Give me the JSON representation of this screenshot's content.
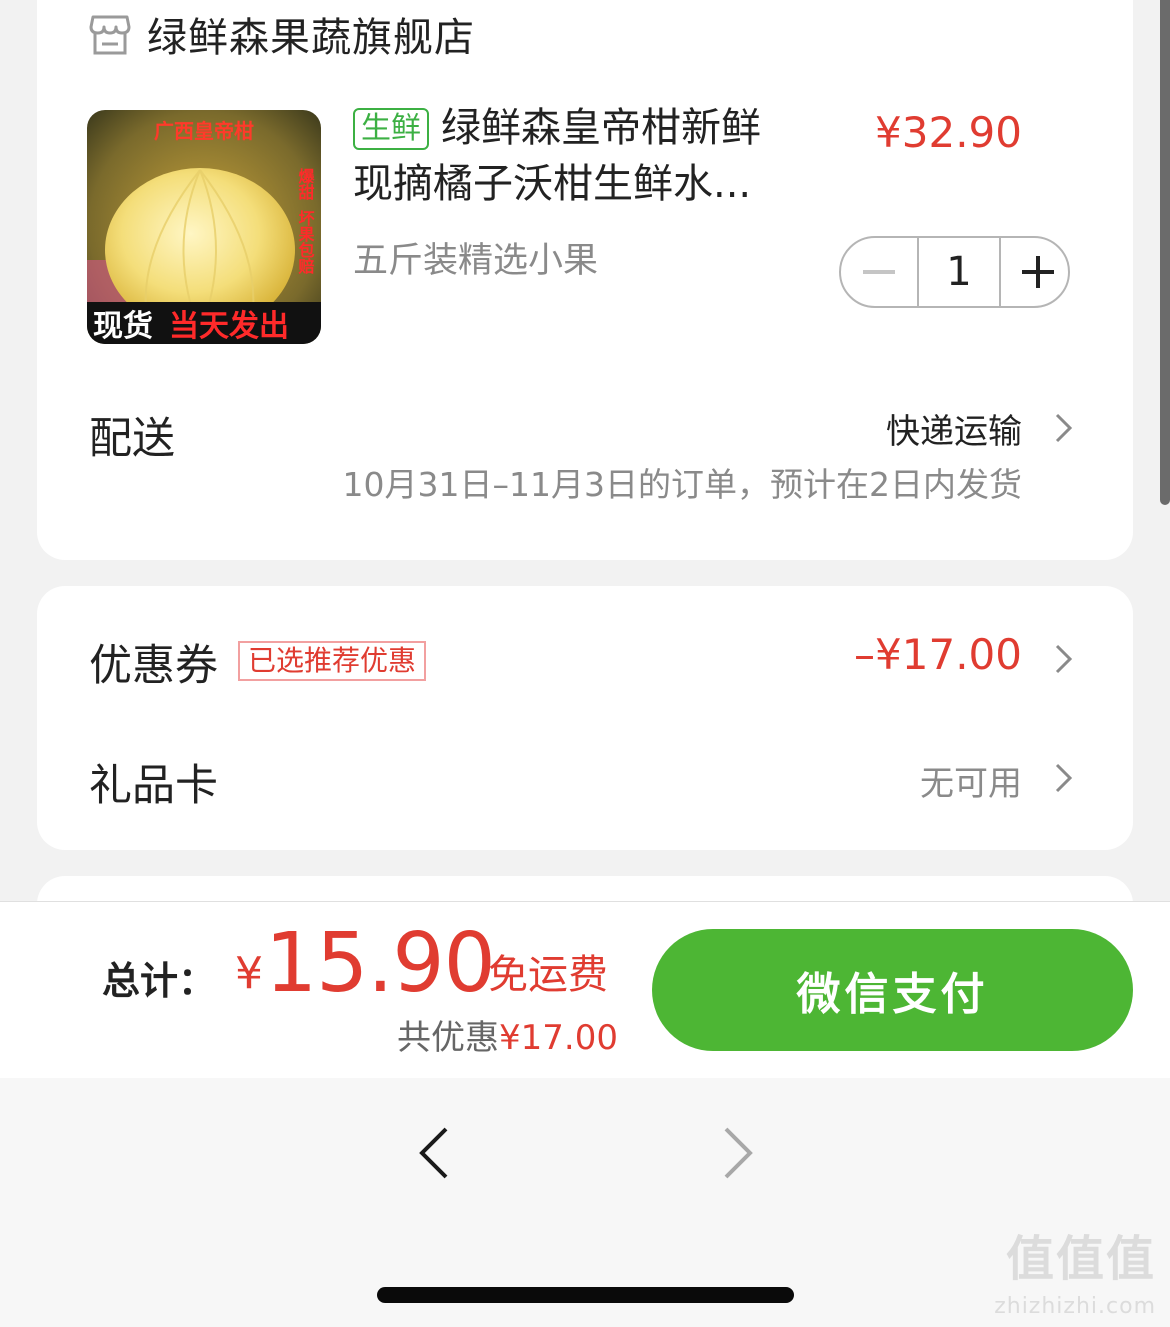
{
  "store": {
    "name": "绿鲜森果蔬旗舰店",
    "icon": "store-icon"
  },
  "product": {
    "tag": "生鲜",
    "title_line1": "绿鲜森皇帝柑新鲜",
    "title_line2": "现摘橘子沃柑生鲜水...",
    "price": "¥32.90",
    "spec": "五斤装精选小果",
    "quantity": "1",
    "image": {
      "top_text": "广西皇帝柑",
      "side_text_1": "爆甜",
      "side_text_2": "坏果包赔",
      "badge_left": "现货",
      "badge_right": "当天发出"
    }
  },
  "delivery": {
    "label": "配送",
    "method": "快递运输",
    "note": "10月31日–11月3日的订单，预计在2日内发货"
  },
  "coupon": {
    "label": "优惠券",
    "tag": "已选推荐优惠",
    "value": "–¥17.00"
  },
  "gift_card": {
    "label": "礼品卡",
    "value": "无可用"
  },
  "footer": {
    "total_label": "总计：",
    "currency": "¥",
    "total_amount": "15.90",
    "free_shipping": "免运费",
    "discount_label": "共优惠",
    "discount_value": "¥17.00",
    "pay_button": "微信支付"
  },
  "watermark": {
    "glyphs": "值值值",
    "url": "zhizhizhi.com"
  },
  "colors": {
    "accent_red": "#e03c31",
    "pay_green": "#4db634",
    "fresh_green": "#3cb043"
  }
}
